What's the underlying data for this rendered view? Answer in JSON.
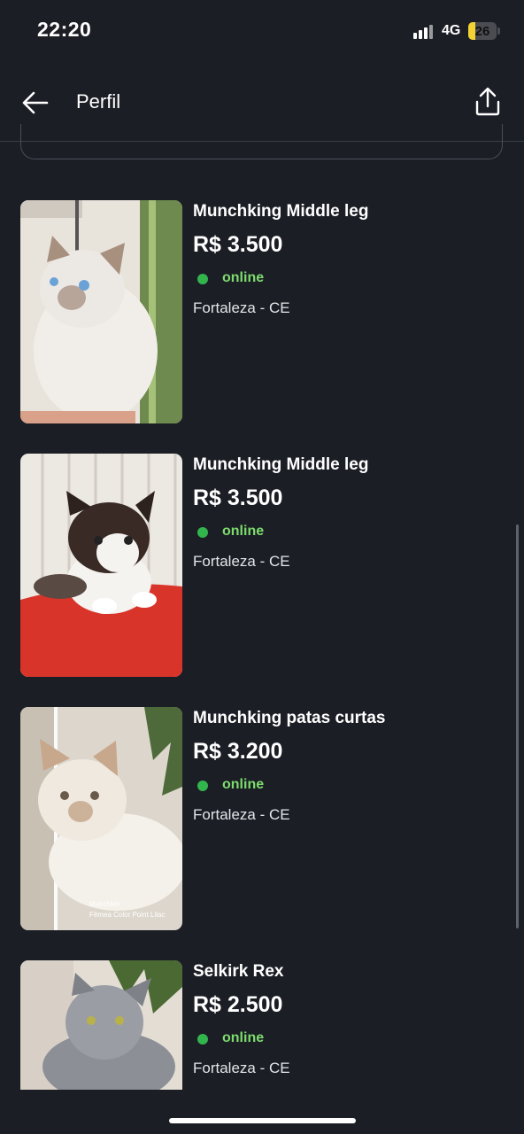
{
  "status_bar": {
    "time": "22:20",
    "network": "4G",
    "battery": "26",
    "battery_level": 0.26
  },
  "header": {
    "title": "Perfil",
    "back_icon": "arrow-left-icon",
    "share_icon": "share-icon"
  },
  "listings": [
    {
      "title": "Munchking Middle leg",
      "price": "R$ 3.500",
      "status": "online",
      "location": "Fortaleza - CE",
      "image": "white-siamese-kitten-photo"
    },
    {
      "title": "Munchking Middle leg",
      "price": "R$ 3.500",
      "status": "online",
      "location": "Fortaleza - CE",
      "image": "calico-kitten-photo"
    },
    {
      "title": "Munchking patas curtas",
      "price": "R$ 3.200",
      "status": "online",
      "location": "Fortaleza - CE",
      "image": "cream-kitten-photo",
      "image_caption": [
        "Munchkin",
        "Fêmea Color Point Lilac"
      ]
    },
    {
      "title": "Selkirk Rex",
      "price": "R$ 2.500",
      "status": "online",
      "location": "Fortaleza - CE",
      "image": "grey-kitten-photo"
    }
  ],
  "colors": {
    "background": "#1b1e25",
    "online_dot": "#32b54d",
    "online_text": "#7ddc6d",
    "battery": "#f3d233"
  }
}
